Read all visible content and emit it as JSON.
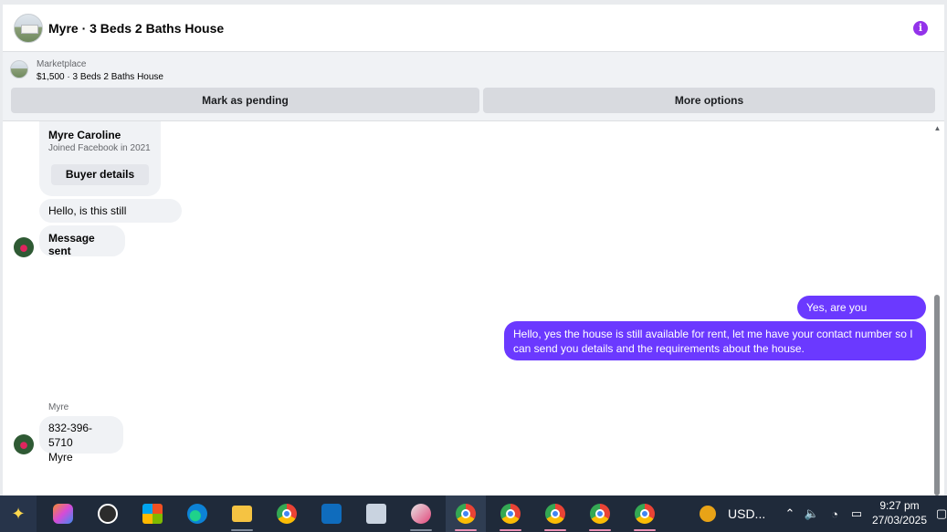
{
  "header": {
    "title": "Myre · 3 Beds 2 Baths House"
  },
  "marketplace": {
    "label": "Marketplace",
    "listing": "$1,500 · 3 Beds 2 Baths House",
    "pending_button": "Mark as pending",
    "more_button": "More options"
  },
  "profile_card": {
    "name": "Myre Caroline",
    "joined": "Joined Facebook in 2021",
    "buyer_button": "Buyer details"
  },
  "messages": [
    {
      "from": "buyer",
      "text": "Hello, is this still available?"
    },
    {
      "from": "buyer",
      "text": "Message sent"
    },
    {
      "from": "seller",
      "text": "Yes, are you interested?"
    },
    {
      "from": "seller",
      "text": "Hello, yes the house is still available for rent, let me have your contact number so I can send you details and the requirements about the house."
    },
    {
      "from": "buyer",
      "sender": "Myre",
      "line1": "832-396-5710",
      "line2": "Myre"
    }
  ],
  "taskbar": {
    "currency": "USD...",
    "time": "9:27 pm",
    "date": "27/03/2025"
  },
  "colors": {
    "accent": "#6b39ff",
    "info": "#9333ea",
    "taskbar": "#1f2a3a"
  }
}
